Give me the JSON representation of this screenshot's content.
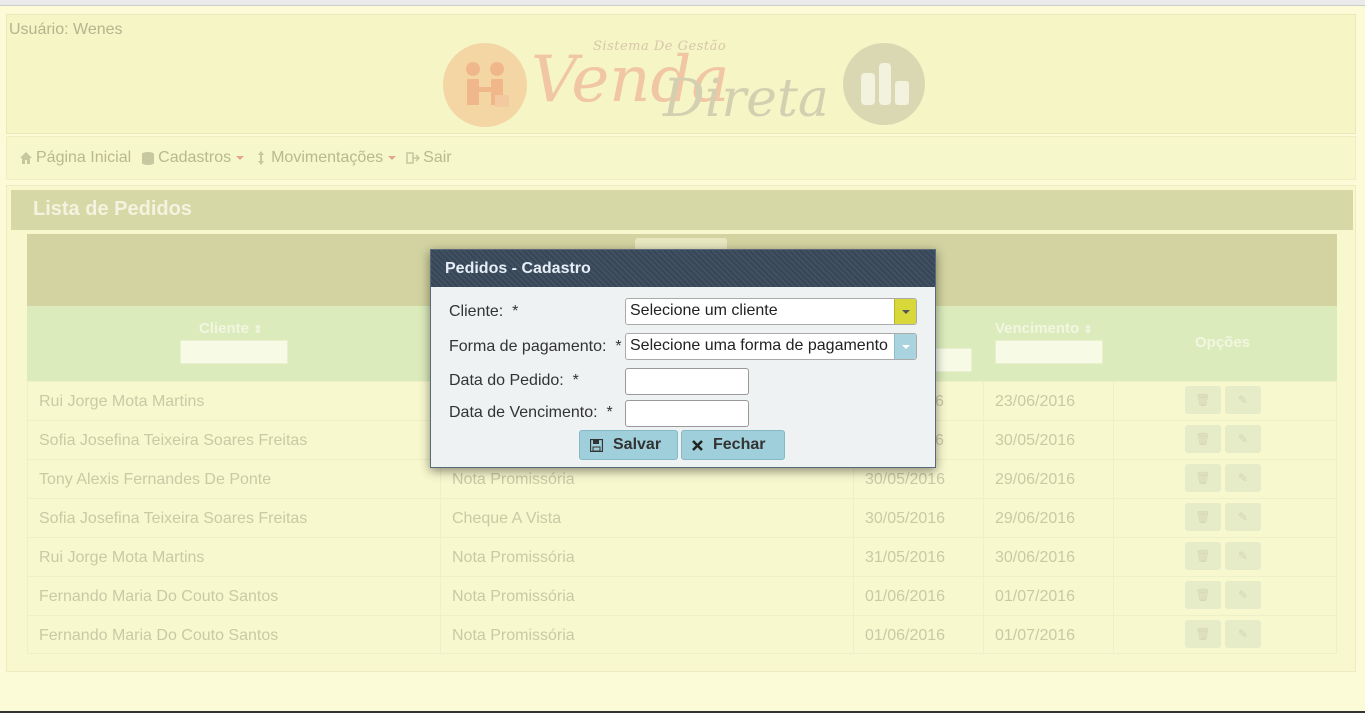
{
  "header": {
    "user_label": "Usuário: Wenes",
    "logo": {
      "subtitle": "Sistema De Gestão",
      "word1": "Venda",
      "word2": "Direta"
    }
  },
  "nav": {
    "items": [
      {
        "label": "Página Inicial",
        "icon": "home-icon"
      },
      {
        "label": "Cadastros",
        "icon": "database-icon"
      },
      {
        "label": "Movimentações",
        "icon": "arrows-vertical-icon"
      },
      {
        "label": "Sair",
        "icon": "sign-out-icon"
      }
    ]
  },
  "panel": {
    "title": "Lista de Pedidos",
    "columns": [
      "Cliente",
      "",
      "",
      "Vencimento",
      "Opções"
    ],
    "rows": [
      {
        "cliente": "Rui Jorge Mota Martins",
        "forma": "",
        "data": "6",
        "vencimento": "23/06/2016"
      },
      {
        "cliente": "Sofia Josefina Teixeira Soares Freitas",
        "forma": "",
        "data": "6",
        "vencimento": "30/05/2016"
      },
      {
        "cliente": "Tony Alexis Fernandes De Ponte",
        "forma": "Nota Promissória",
        "data": "30/05/2016",
        "vencimento": "29/06/2016"
      },
      {
        "cliente": "Sofia Josefina Teixeira Soares Freitas",
        "forma": "Cheque A Vista",
        "data": "30/05/2016",
        "vencimento": "29/06/2016"
      },
      {
        "cliente": "Rui Jorge Mota Martins",
        "forma": "Nota Promissória",
        "data": "31/05/2016",
        "vencimento": "30/06/2016"
      },
      {
        "cliente": "Fernando Maria Do Couto Santos",
        "forma": "Nota Promissória",
        "data": "01/06/2016",
        "vencimento": "01/07/2016"
      },
      {
        "cliente": "Fernando Maria Do Couto Santos",
        "forma": "Nota Promissória",
        "data": "01/06/2016",
        "vencimento": "01/07/2016"
      }
    ]
  },
  "modal": {
    "title": "Pedidos - Cadastro",
    "fields": {
      "cliente": {
        "label": "Cliente:",
        "required": "*",
        "value": "Selecione um cliente"
      },
      "forma": {
        "label": "Forma de pagamento:",
        "required": "*",
        "value": "Selecione uma forma de pagamento"
      },
      "data_pedido": {
        "label": "Data do Pedido:",
        "required": "*",
        "value": ""
      },
      "data_vencimento": {
        "label": "Data de Vencimento:",
        "required": "*",
        "value": ""
      }
    },
    "buttons": {
      "save": "Salvar",
      "close": "Fechar"
    }
  },
  "colors": {
    "overlay_yellow": "#fbfbd8",
    "modal_header": "#3a4a5c",
    "button_blue": "#9fcfda",
    "select_arrow_yellow": "#d8d83a"
  }
}
